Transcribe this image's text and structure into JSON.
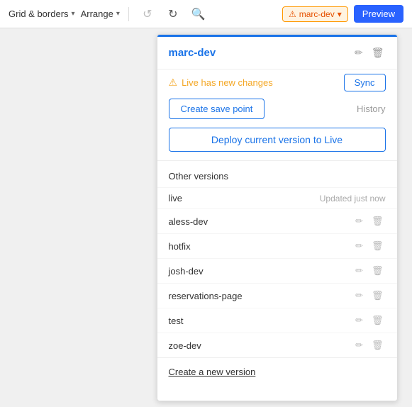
{
  "toolbar": {
    "grid_borders_label": "Grid & borders",
    "arrange_label": "Arrange",
    "undo_label": "Undo",
    "redo_label": "Redo",
    "search_label": "Search",
    "alert_label": "marc-dev",
    "preview_label": "Preview"
  },
  "panel": {
    "title": "marc-dev",
    "alert_message": "Live has new changes",
    "sync_btn": "Sync",
    "create_save_btn": "Create save point",
    "history_label": "History",
    "deploy_btn": "Deploy current version to Live",
    "other_versions_label": "Other versions",
    "versions": [
      {
        "name": "live",
        "sub": "Updated just now",
        "show_icons": false
      },
      {
        "name": "aless-dev",
        "sub": "",
        "show_icons": true
      },
      {
        "name": "hotfix",
        "sub": "",
        "show_icons": true
      },
      {
        "name": "josh-dev",
        "sub": "",
        "show_icons": true
      },
      {
        "name": "reservations-page",
        "sub": "",
        "show_icons": true
      },
      {
        "name": "test",
        "sub": "",
        "show_icons": true
      },
      {
        "name": "zoe-dev",
        "sub": "",
        "show_icons": true
      }
    ],
    "create_new_version": "Create a new version"
  }
}
